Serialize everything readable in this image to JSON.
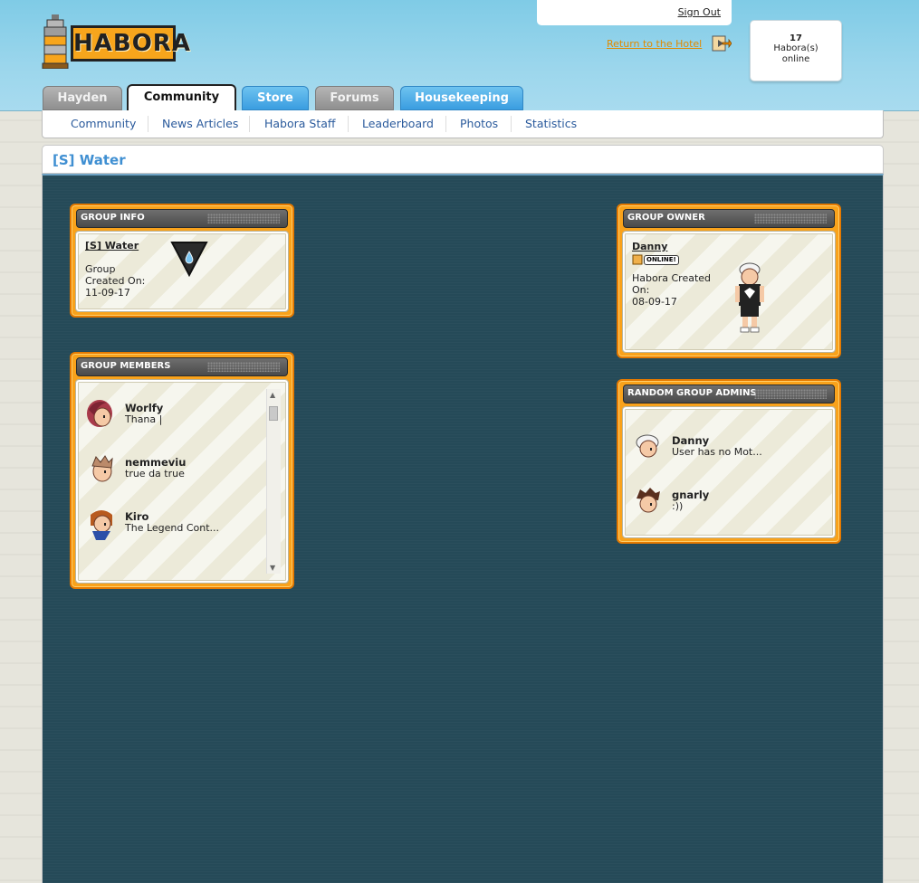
{
  "site": {
    "logo_text": "HABORA"
  },
  "header": {
    "sign_out": "Sign Out",
    "return_hotel": "Return to the Hotel",
    "online": {
      "count": "17",
      "line1": "Habora(s)",
      "line2": "online"
    }
  },
  "tabs": [
    {
      "label": "Hayden"
    },
    {
      "label": "Community"
    },
    {
      "label": "Store"
    },
    {
      "label": "Forums"
    },
    {
      "label": "Housekeeping"
    }
  ],
  "subnav": [
    {
      "label": "Community"
    },
    {
      "label": "News Articles"
    },
    {
      "label": "Habora Staff"
    },
    {
      "label": "Leaderboard"
    },
    {
      "label": "Photos"
    },
    {
      "label": "Statistics"
    }
  ],
  "page": {
    "title": "[S] Water"
  },
  "group_info": {
    "heading": "GROUP INFO",
    "name": "[S] Water",
    "line1": "Group",
    "line2": "Created On:",
    "date": "11-09-17",
    "badge_icon": "water-drop-badge"
  },
  "group_owner": {
    "heading": "GROUP OWNER",
    "name": "Danny",
    "status": "ONLINE!",
    "line1": "Habora Created",
    "line2": "On:",
    "date": "08-09-17"
  },
  "group_members": {
    "heading": "GROUP MEMBERS",
    "items": [
      {
        "name": "Worlfy",
        "motto": "Thana |"
      },
      {
        "name": "nemmeviu",
        "motto": "true da true"
      },
      {
        "name": "Kiro",
        "motto": "The Legend Cont..."
      }
    ]
  },
  "group_admins": {
    "heading": "RANDOM GROUP ADMINS",
    "items": [
      {
        "name": "Danny",
        "motto": "User has no Mot..."
      },
      {
        "name": "gnarly",
        "motto": ":))"
      }
    ]
  },
  "colors": {
    "accent": "#f9a21b",
    "main_bg": "#254a58",
    "title_blue": "#3f8fd2"
  }
}
